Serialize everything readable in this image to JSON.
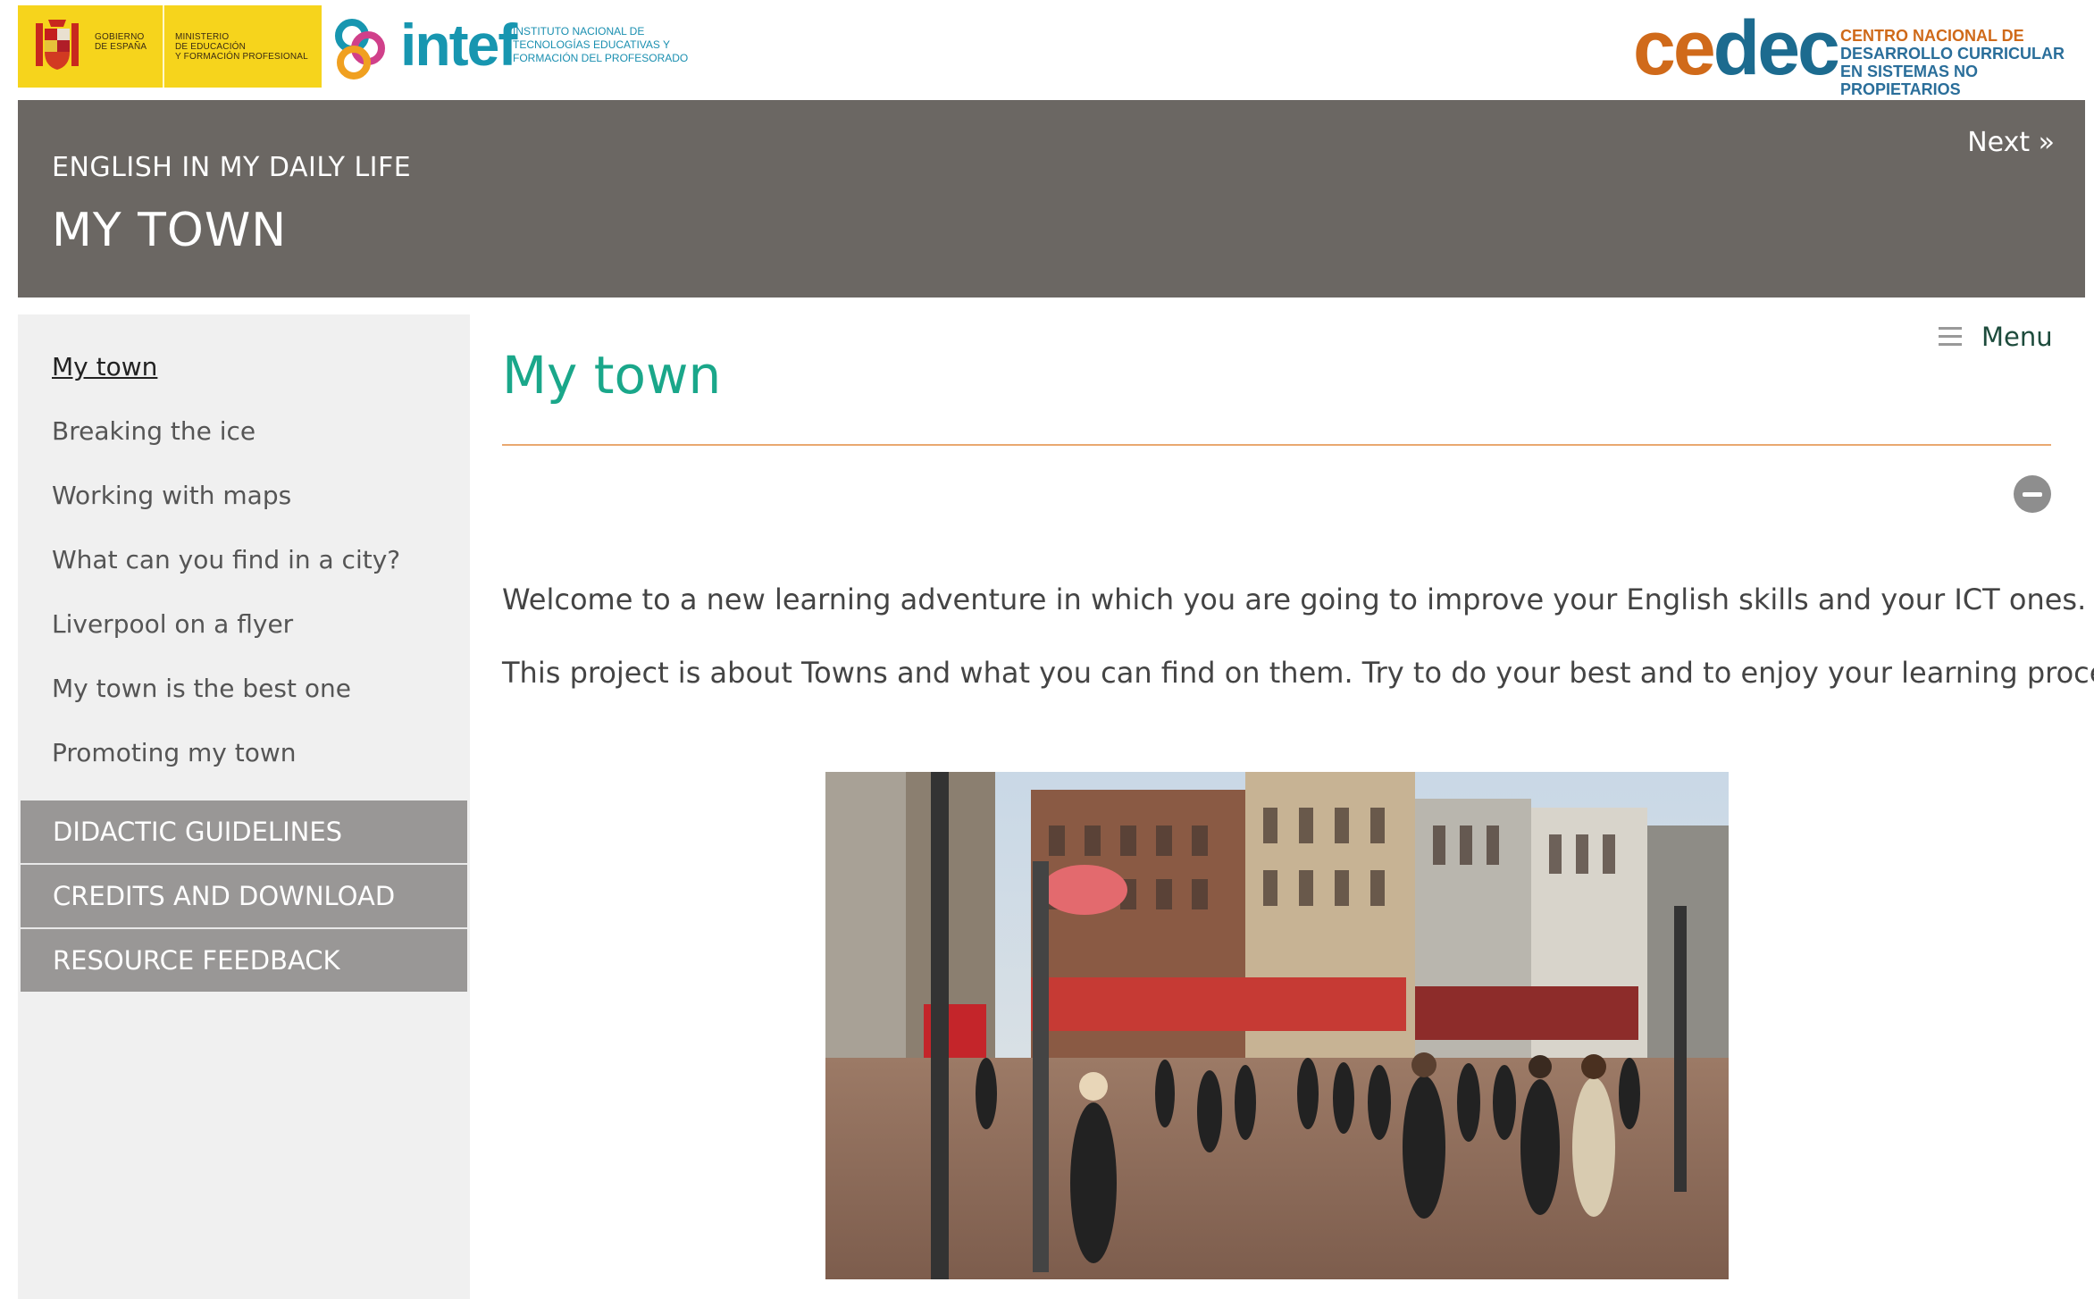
{
  "logos": {
    "gobierno_line": [
      "GOBIERNO",
      "DE ESPAÑA"
    ],
    "ministerio_line": [
      "MINISTERIO",
      "DE EDUCACIÓN",
      "Y FORMACIÓN PROFESIONAL"
    ],
    "intef_name": "intef",
    "intef_sub": [
      "INSTITUTO NACIONAL DE",
      "TECNOLOGÍAS EDUCATIVAS Y",
      "FORMACIÓN DEL PROFESORADO"
    ],
    "cedec_name_a": "ce",
    "cedec_name_b": "dec",
    "cedec_sub": [
      "CENTRO NACIONAL DE",
      "DESARROLLO CURRICULAR",
      "EN SISTEMAS NO PROPIETARIOS"
    ]
  },
  "banner": {
    "course": "ENGLISH IN MY DAILY LIFE",
    "unit": "MY TOWN",
    "next": "Next »"
  },
  "sidebar": {
    "items": [
      {
        "label": "My town",
        "active": true
      },
      {
        "label": "Breaking the ice"
      },
      {
        "label": "Working with maps"
      },
      {
        "label": "What can you find in a city?"
      },
      {
        "label": "Liverpool on a flyer"
      },
      {
        "label": "My town is the best one"
      },
      {
        "label": "Promoting my town"
      }
    ],
    "buttons": [
      {
        "label": "DIDACTIC GUIDELINES"
      },
      {
        "label": "CREDITS AND DOWNLOAD"
      },
      {
        "label": "RESOURCE FEEDBACK"
      }
    ]
  },
  "main": {
    "menu_label": "Menu",
    "title": "My town",
    "paragraphs": [
      "Welcome to a new learning adventure in which you are going to improve your English skills and your ICT ones.",
      "This project is about Towns and what you can find on them. Try to do your best and to enjoy your learning process."
    ]
  },
  "colors": {
    "banner_bg": "#6b6763",
    "title_green": "#1aa78a",
    "rule_orange": "#e9a870",
    "sidebar_bg": "#f0f0f0",
    "nav_button_bg": "#999796"
  }
}
